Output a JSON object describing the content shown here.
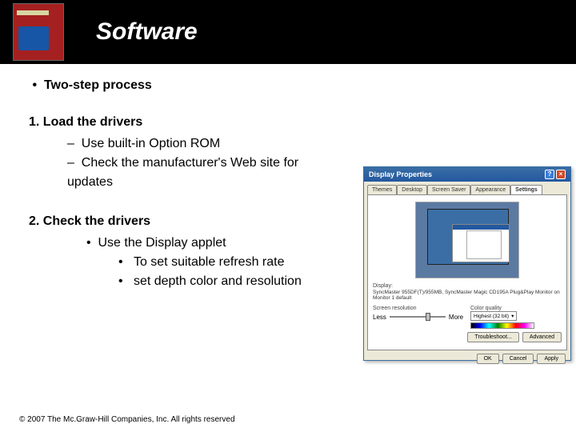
{
  "header": {
    "title": "Software"
  },
  "main_bullet": "Two-step process",
  "sections": [
    {
      "num": "1.",
      "title": "Load the drivers",
      "items": [
        "Use built-in Option ROM",
        "Check the manufacturer's Web site for updates"
      ]
    },
    {
      "num": "2.",
      "title": "Check the drivers",
      "items": [
        "Use the Display applet"
      ],
      "subitems": [
        "To set suitable refresh rate",
        "set depth color and resolution"
      ]
    }
  ],
  "dialog": {
    "title": "Display Properties",
    "tabs": [
      "Themes",
      "Desktop",
      "Screen Saver",
      "Appearance",
      "Settings"
    ],
    "active_tab": "Settings",
    "display_label": "Display:",
    "display_value": "SyncMaster 955DF(T)/955MB, SyncMaster Magic CD195A Plug&Play Monitor on Monitor 1 default",
    "resolution_label": "Screen resolution",
    "less": "Less",
    "more": "More",
    "quality_label": "Color quality",
    "quality_value": "Highest (32 bit)",
    "troubleshoot": "Troubleshoot...",
    "advanced": "Advanced",
    "ok": "OK",
    "cancel": "Cancel",
    "apply": "Apply"
  },
  "footer": "© 2007 The Mc.Graw-Hill Companies, Inc. All rights reserved"
}
